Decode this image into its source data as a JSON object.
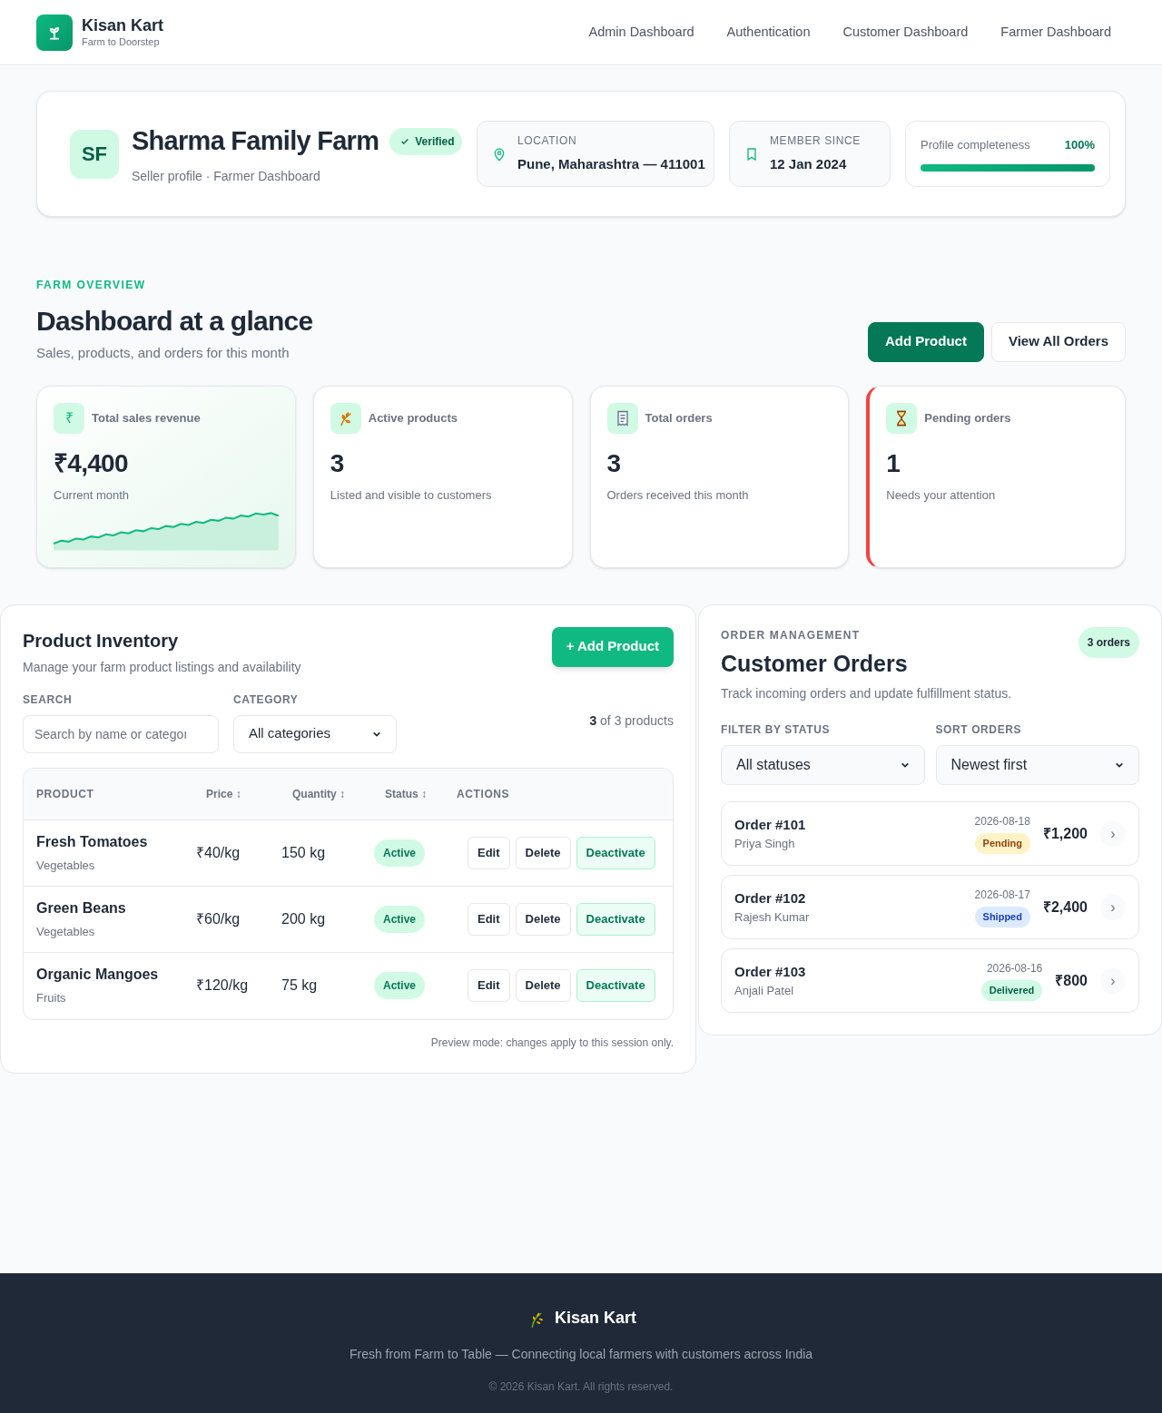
{
  "brand": {
    "name": "Kisan Kart",
    "tagline": "Farm to Doorstep"
  },
  "nav": [
    "Admin Dashboard",
    "Authentication",
    "Customer Dashboard",
    "Farmer Dashboard"
  ],
  "profile": {
    "initials": "SF",
    "name": "Sharma Family Farm",
    "verified": true,
    "badge": "Verified",
    "subtitle": "Seller profile · Farmer Dashboard",
    "location": {
      "label": "LOCATION",
      "value": "Pune, Maharashtra — 411001"
    },
    "member": {
      "label": "MEMBER SINCE",
      "value": "12 Jan 2024"
    },
    "completeness": {
      "label": "Profile completeness",
      "reading": "100%",
      "level": 1
    }
  },
  "overview": {
    "eyebrow": "FARM OVERVIEW",
    "title": "Dashboard at a glance",
    "subtitle": "Sales, products, and orders for this month",
    "buttons": [
      {
        "label": "Add Product",
        "kind": "primary"
      },
      {
        "label": "View All Orders",
        "kind": "secondary"
      }
    ]
  },
  "stats": [
    {
      "kind": "revenue",
      "icon_text": "₹",
      "label": "Total sales revenue",
      "value": "₹4,400",
      "note": "Current month",
      "alert": false
    },
    {
      "kind": "products",
      "label": "Active products",
      "value": "3",
      "note": "Listed and visible to customers",
      "alert": false
    },
    {
      "kind": "orders",
      "label": "Total orders",
      "value": "3",
      "note": "Orders received this month",
      "alert": false
    },
    {
      "kind": "pending",
      "label": "Pending orders",
      "value": "1",
      "note": "Needs your attention",
      "alert": true
    }
  ],
  "inventory": {
    "title": "Product Inventory",
    "subtitle": "Manage your farm product listings and availability",
    "add_button": "+ Add Product",
    "search": {
      "label": "SEARCH",
      "placeholder": "Search by name or categoı"
    },
    "category": {
      "label": "CATEGORY",
      "value": "All categories"
    },
    "count": {
      "shown": "3",
      "rest": "of 3 products"
    },
    "columns": [
      "PRODUCT",
      "Price ↕",
      "Quantity ↕",
      "Status ↕",
      "ACTIONS"
    ],
    "rows": [
      {
        "name": "Fresh Tomatoes",
        "category": "Vegetables",
        "price": "₹40/kg",
        "quantity": "150 kg",
        "status": "Active",
        "actions": [
          "Edit",
          "Delete",
          "Deactivate"
        ]
      },
      {
        "name": "Green Beans",
        "category": "Vegetables",
        "price": "₹60/kg",
        "quantity": "200 kg",
        "status": "Active",
        "actions": [
          "Edit",
          "Delete",
          "Deactivate"
        ]
      },
      {
        "name": "Organic Mangoes",
        "category": "Fruits",
        "price": "₹120/kg",
        "quantity": "75 kg",
        "status": "Active",
        "actions": [
          "Edit",
          "Delete",
          "Deactivate"
        ]
      }
    ],
    "note": "Preview mode: changes apply to this session only."
  },
  "orders": {
    "eyebrow": "ORDER MANAGEMENT",
    "title": "Customer Orders",
    "count_badge": "3 orders",
    "subtitle": "Track incoming orders and update fulfillment status.",
    "filter": {
      "label": "FILTER BY STATUS",
      "value": "All statuses"
    },
    "sort": {
      "label": "SORT ORDERS",
      "value": "Newest first"
    },
    "items": [
      {
        "id": "Order #101",
        "customer": "Priya Singh",
        "date": "2026-08-18",
        "status": "Pending",
        "kind": "pending",
        "total": "₹1,200",
        "chevron": "›"
      },
      {
        "id": "Order #102",
        "customer": "Rajesh Kumar",
        "date": "2026-08-17",
        "status": "Shipped",
        "kind": "shipped",
        "total": "₹2,400",
        "chevron": "›"
      },
      {
        "id": "Order #103",
        "customer": "Anjali Patel",
        "date": "2026-08-16",
        "status": "Delivered",
        "kind": "delivered",
        "total": "₹800",
        "chevron": "›"
      }
    ]
  },
  "footer": {
    "brand": "Kisan Kart",
    "tagline": "Fresh from Farm to Table — Connecting local farmers with customers across India",
    "copyright": "© 2026 Kisan Kart. All rights reserved."
  }
}
